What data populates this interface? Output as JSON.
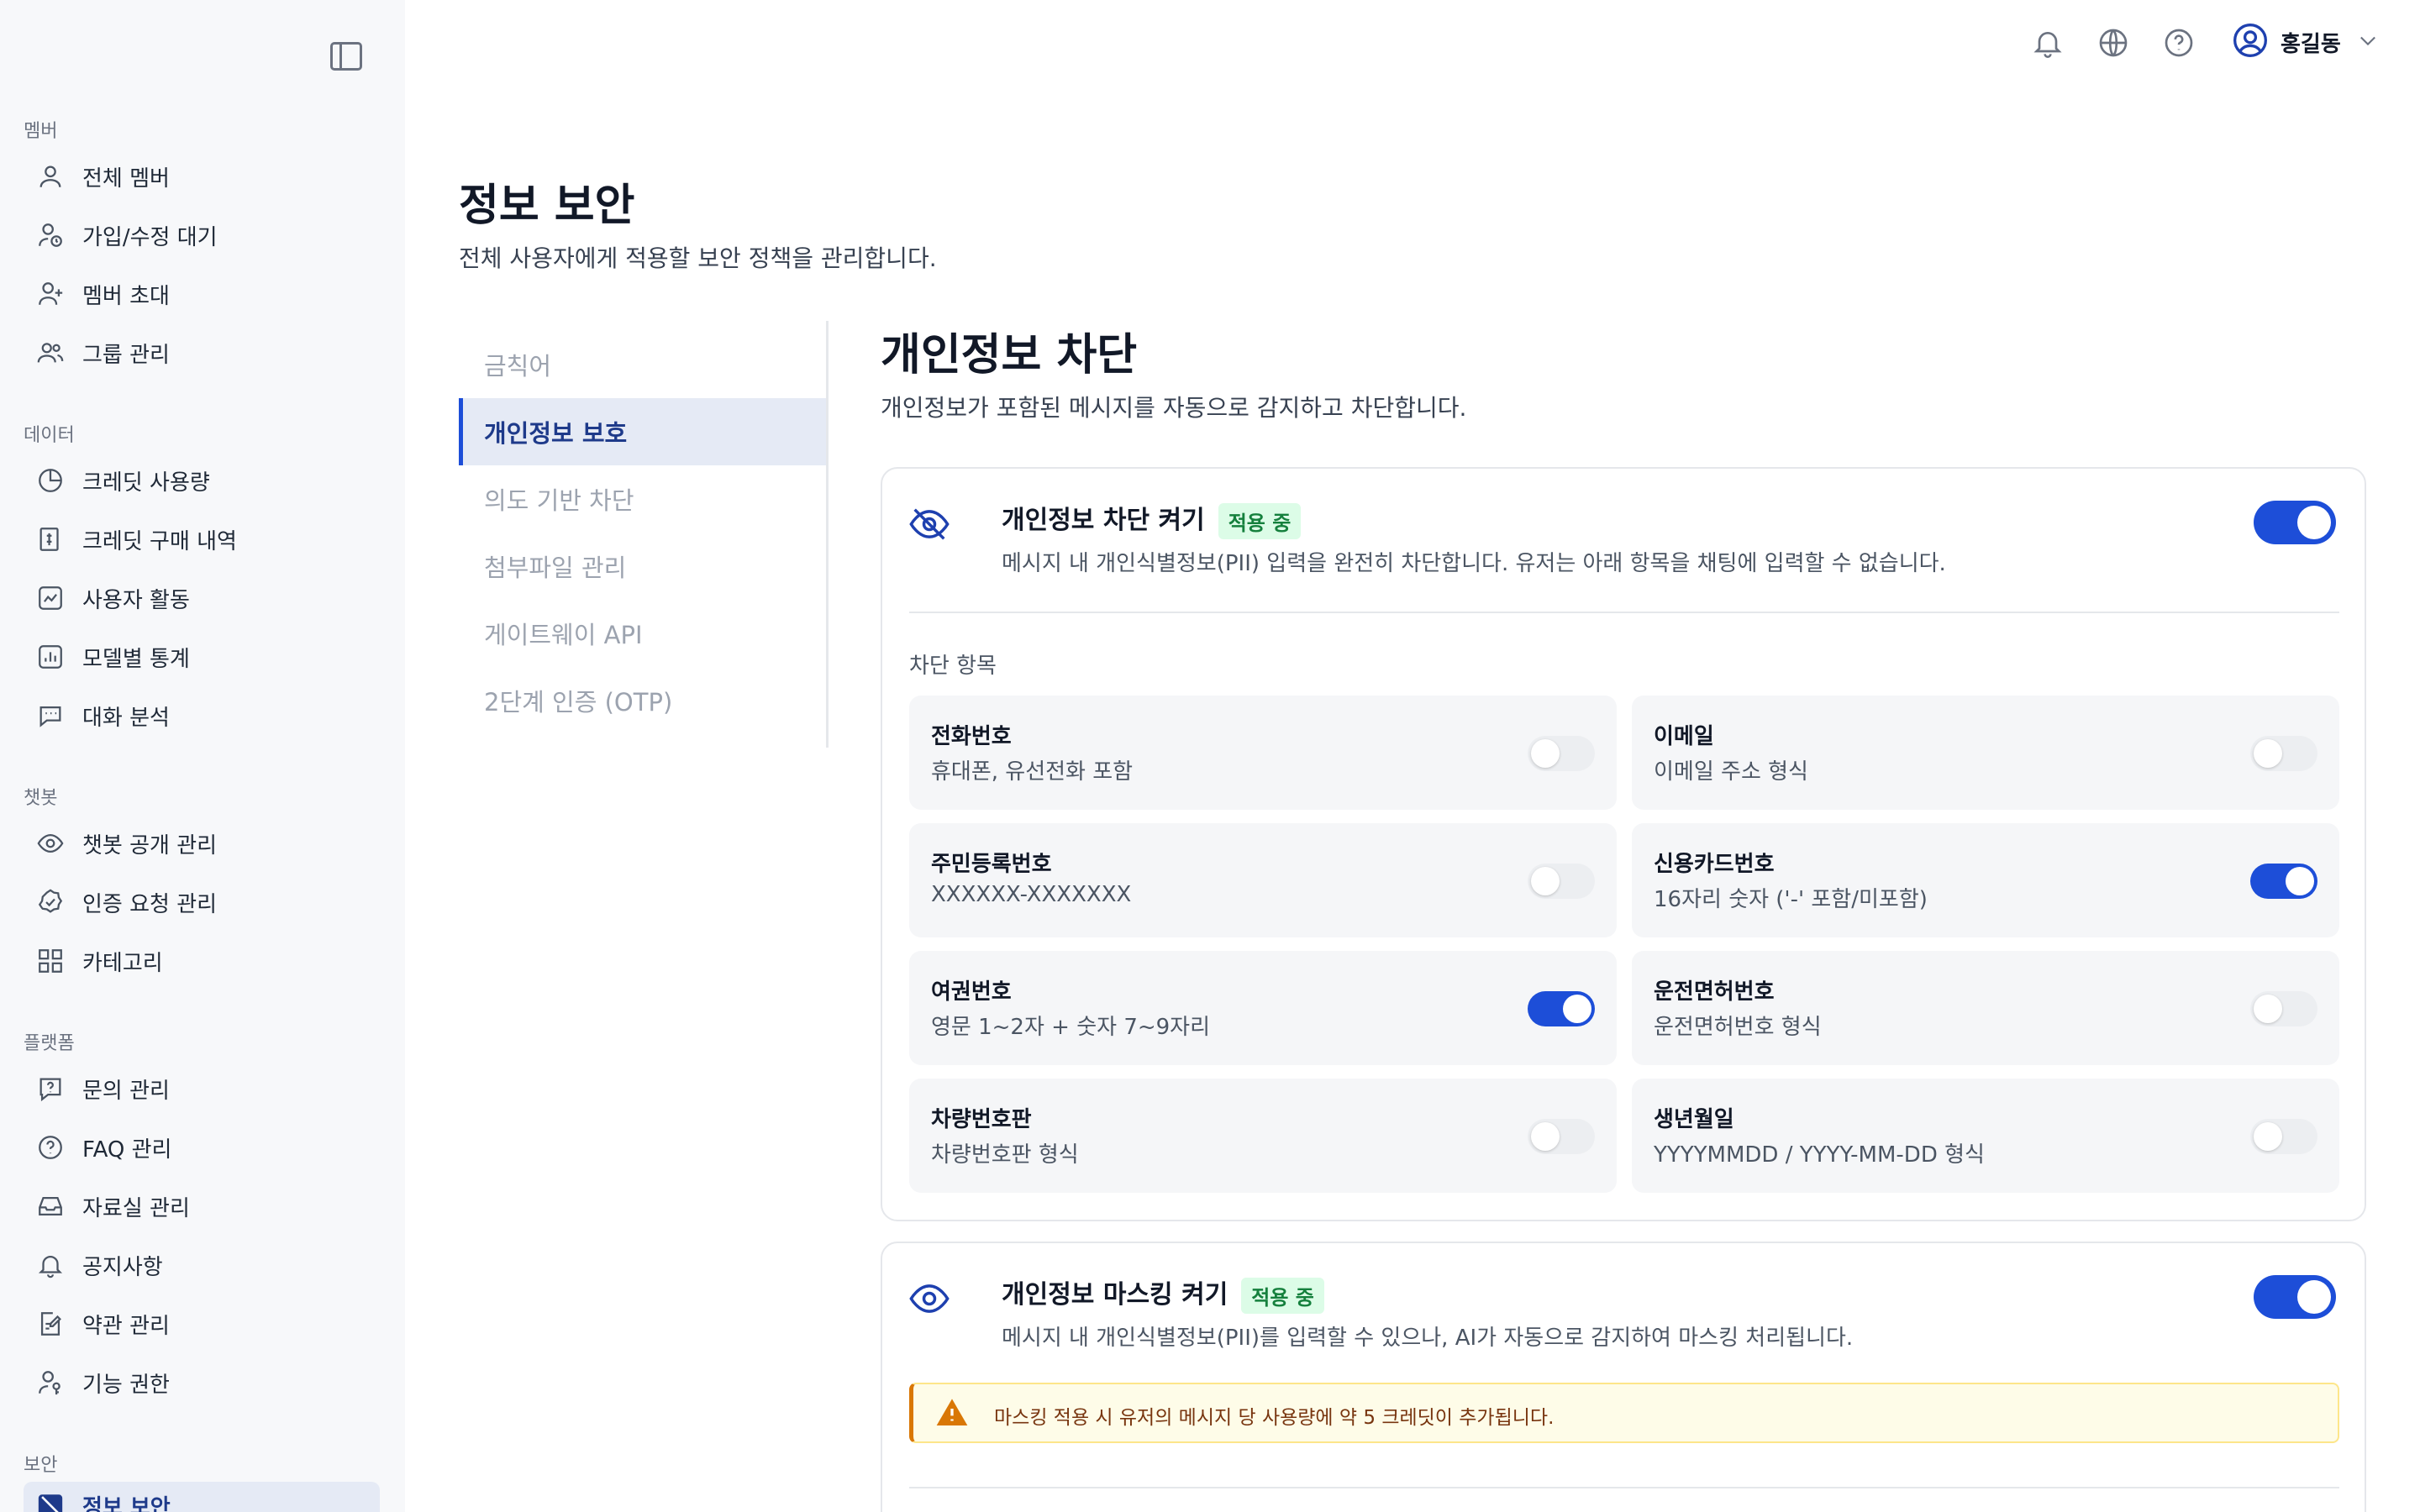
{
  "header": {
    "user_name": "홍길동"
  },
  "sidebar": {
    "sections": [
      {
        "title": "멤버",
        "items": [
          {
            "label": "전체 멤버",
            "icon": "user-icon"
          },
          {
            "label": "가입/수정 대기",
            "icon": "user-clock-icon"
          },
          {
            "label": "멤버 초대",
            "icon": "user-plus-icon"
          },
          {
            "label": "그룹 관리",
            "icon": "users-icon"
          }
        ]
      },
      {
        "title": "데이터",
        "items": [
          {
            "label": "크레딧 사용량",
            "icon": "pie-chart-icon"
          },
          {
            "label": "크레딧 구매 내역",
            "icon": "receipt-icon"
          },
          {
            "label": "사용자 활동",
            "icon": "activity-icon"
          },
          {
            "label": "모델별 통계",
            "icon": "bar-chart-icon"
          },
          {
            "label": "대화 분석",
            "icon": "chat-icon"
          }
        ]
      },
      {
        "title": "챗봇",
        "items": [
          {
            "label": "챗봇 공개 관리",
            "icon": "eye-icon"
          },
          {
            "label": "인증 요청 관리",
            "icon": "badge-check-icon"
          },
          {
            "label": "카테고리",
            "icon": "grid-icon"
          }
        ]
      },
      {
        "title": "플랫폼",
        "items": [
          {
            "label": "문의 관리",
            "icon": "question-message-icon"
          },
          {
            "label": "FAQ 관리",
            "icon": "question-circle-icon"
          },
          {
            "label": "자료실 관리",
            "icon": "inbox-icon"
          },
          {
            "label": "공지사항",
            "icon": "bell-icon"
          },
          {
            "label": "약관 관리",
            "icon": "document-edit-icon"
          },
          {
            "label": "기능 권한",
            "icon": "user-key-icon"
          }
        ]
      },
      {
        "title": "보안",
        "items": [
          {
            "label": "정보 보안",
            "icon": "shield-off-icon",
            "active": true
          }
        ]
      }
    ]
  },
  "page": {
    "title": "정보 보안",
    "description": "전체 사용자에게 적용할 보안 정책을 관리합니다."
  },
  "subnav": [
    {
      "label": "금칙어"
    },
    {
      "label": "개인정보 보호",
      "active": true
    },
    {
      "label": "의도 기반 차단"
    },
    {
      "label": "첨부파일 관리"
    },
    {
      "label": "게이트웨이 API"
    },
    {
      "label": "2단계 인증 (OTP)"
    }
  ],
  "section": {
    "title": "개인정보 차단",
    "description": "개인정보가 포함된 메시지를 자동으로 감지하고 차단합니다."
  },
  "block_card": {
    "title": "개인정보 차단 켜기",
    "badge": "적용 중",
    "description": "메시지 내 개인식별정보(PII) 입력을 완전히 차단합니다. 유저는 아래 항목을 채팅에 입력할 수 없습니다.",
    "enabled": true,
    "items_label": "차단 항목",
    "items": [
      {
        "title": "전화번호",
        "desc": "휴대폰, 유선전화 포함",
        "on": false
      },
      {
        "title": "이메일",
        "desc": "이메일 주소 형식",
        "on": false
      },
      {
        "title": "주민등록번호",
        "desc": "XXXXXX-XXXXXXX",
        "on": false
      },
      {
        "title": "신용카드번호",
        "desc": "16자리 숫자 ('-' 포함/미포함)",
        "on": true
      },
      {
        "title": "여권번호",
        "desc": "영문 1~2자 + 숫자 7~9자리",
        "on": true
      },
      {
        "title": "운전면허번호",
        "desc": "운전면허번호 형식",
        "on": false
      },
      {
        "title": "차량번호판",
        "desc": "차량번호판 형식",
        "on": false
      },
      {
        "title": "생년월일",
        "desc": "YYYYMMDD / YYYY-MM-DD 형식",
        "on": false
      }
    ]
  },
  "mask_card": {
    "title": "개인정보 마스킹 켜기",
    "badge": "적용 중",
    "description": "메시지 내 개인식별정보(PII)를 입력할 수 있으나, AI가 자동으로 감지하여 마스킹 처리됩니다.",
    "enabled": true,
    "warning": "마스킹 적용 시 유저의 메시지 당 사용량에 약 5 크레딧이 추가됩니다."
  },
  "colors": {
    "accent": "#1d4ed8",
    "badge_bg": "#dcfce7",
    "badge_text": "#15803d",
    "warning": "#d97706"
  }
}
